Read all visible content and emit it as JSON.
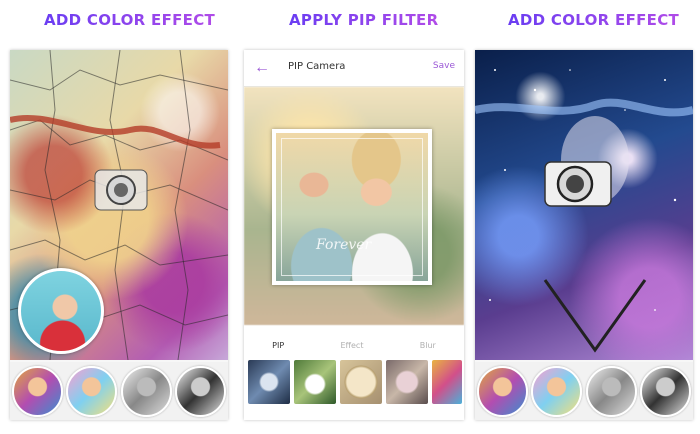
{
  "headings": {
    "left": "ADD COLOR EFFECT",
    "middle": "APPLY PIP FILTER",
    "right": "ADD COLOR EFFECT"
  },
  "pip_screen": {
    "title": "PIP Camera",
    "save_label": "Save",
    "watermark": "Forever",
    "tabs": [
      {
        "label": "PIP",
        "active": true
      },
      {
        "label": "Effect",
        "active": false
      },
      {
        "label": "Blur",
        "active": false
      }
    ]
  },
  "colors": {
    "heading_gradient_start": "#6a3df2",
    "heading_gradient_end": "#b04be8",
    "accent": "#9b59d6"
  },
  "icons": {
    "back": "arrow-left-icon"
  }
}
